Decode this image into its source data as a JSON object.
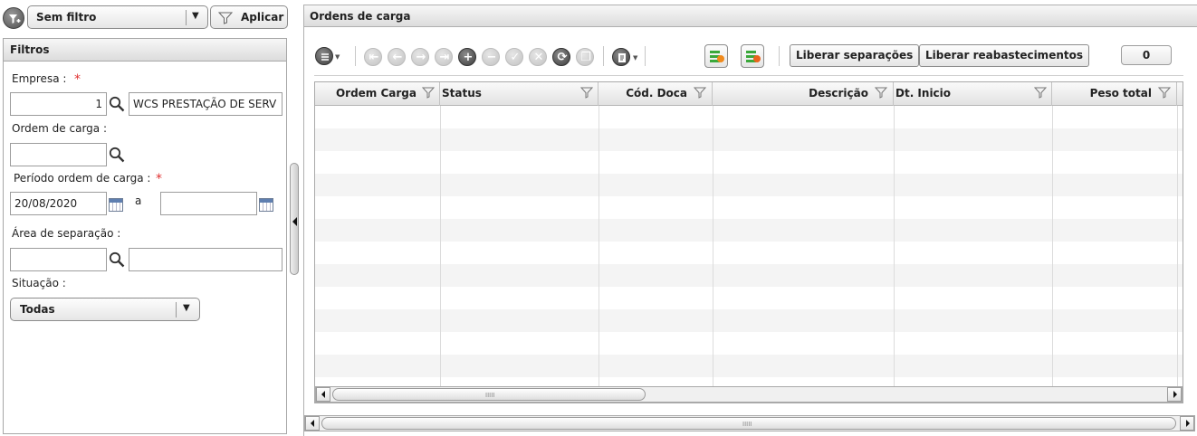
{
  "filter_bar": {
    "selected_filter": "Sem filtro",
    "apply_label": "Aplicar"
  },
  "filters_panel": {
    "title": "Filtros",
    "empresa": {
      "label": "Empresa :",
      "code": "1",
      "name": "WCS PRESTAÇÃO DE SERV"
    },
    "ordem_carga": {
      "label": "Ordem de carga :",
      "value": ""
    },
    "periodo": {
      "label": "Período ordem de carga :",
      "start": "20/08/2020",
      "separator": "a",
      "end": ""
    },
    "area_separacao": {
      "label": "Área de separação :",
      "code": "",
      "name": ""
    },
    "situacao": {
      "label": "Situação :",
      "selected": "Todas"
    },
    "required_mark": "*"
  },
  "main": {
    "title": "Ordens de carga",
    "toolbar": {
      "liberar_separacoes": "Liberar separações",
      "liberar_reabastecimentos": "Liberar reabastecimentos",
      "counter": "0"
    },
    "grid": {
      "columns": [
        {
          "label": "Ordem Carga",
          "align": "right"
        },
        {
          "label": "Status",
          "align": "left"
        },
        {
          "label": "Cód. Doca",
          "align": "right"
        },
        {
          "label": "Descrição",
          "align": "right"
        },
        {
          "label": "Dt. Inicio",
          "align": "left"
        },
        {
          "label": "Peso total",
          "align": "right"
        }
      ],
      "rows": []
    }
  },
  "icons": {
    "filter_menu": "filter-menu-icon",
    "funnel": "funnel-icon",
    "search": "magnifier-icon",
    "calendar": "calendar-icon"
  },
  "colors": {
    "header_bg": "#dcdcdc",
    "required": "#e03030",
    "accent_orange": "#f08a1c",
    "accent_green": "#3aa83a"
  }
}
